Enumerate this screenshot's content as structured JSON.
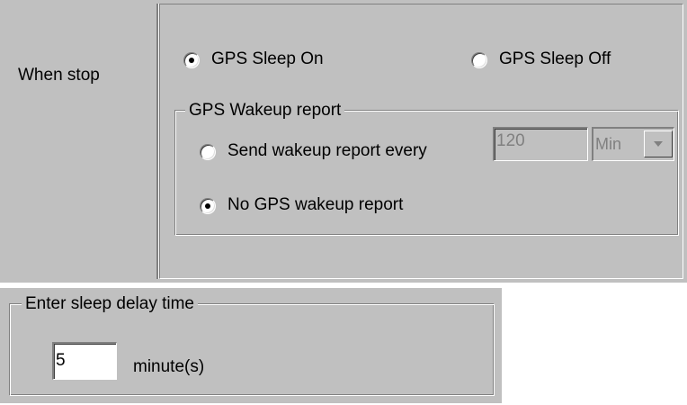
{
  "when_stop": {
    "label": "When stop",
    "sleep_on_label": "GPS Sleep On",
    "sleep_off_label": "GPS Sleep Off",
    "selected": "GPS Sleep On"
  },
  "wakeup_group": {
    "legend": "GPS Wakeup report",
    "send_every_label": "Send wakeup report every",
    "interval_value": "120",
    "unit_value": "Min",
    "no_report_label": "No GPS wakeup report",
    "selected": "No GPS wakeup report"
  },
  "sleep_delay": {
    "legend": "Enter sleep delay time",
    "value": "5",
    "unit_label": "minute(s)"
  },
  "colors": {
    "face": "#c0c0c0",
    "shadow": "#808080",
    "highlight": "#ffffff",
    "disabled_text": "#808080"
  }
}
